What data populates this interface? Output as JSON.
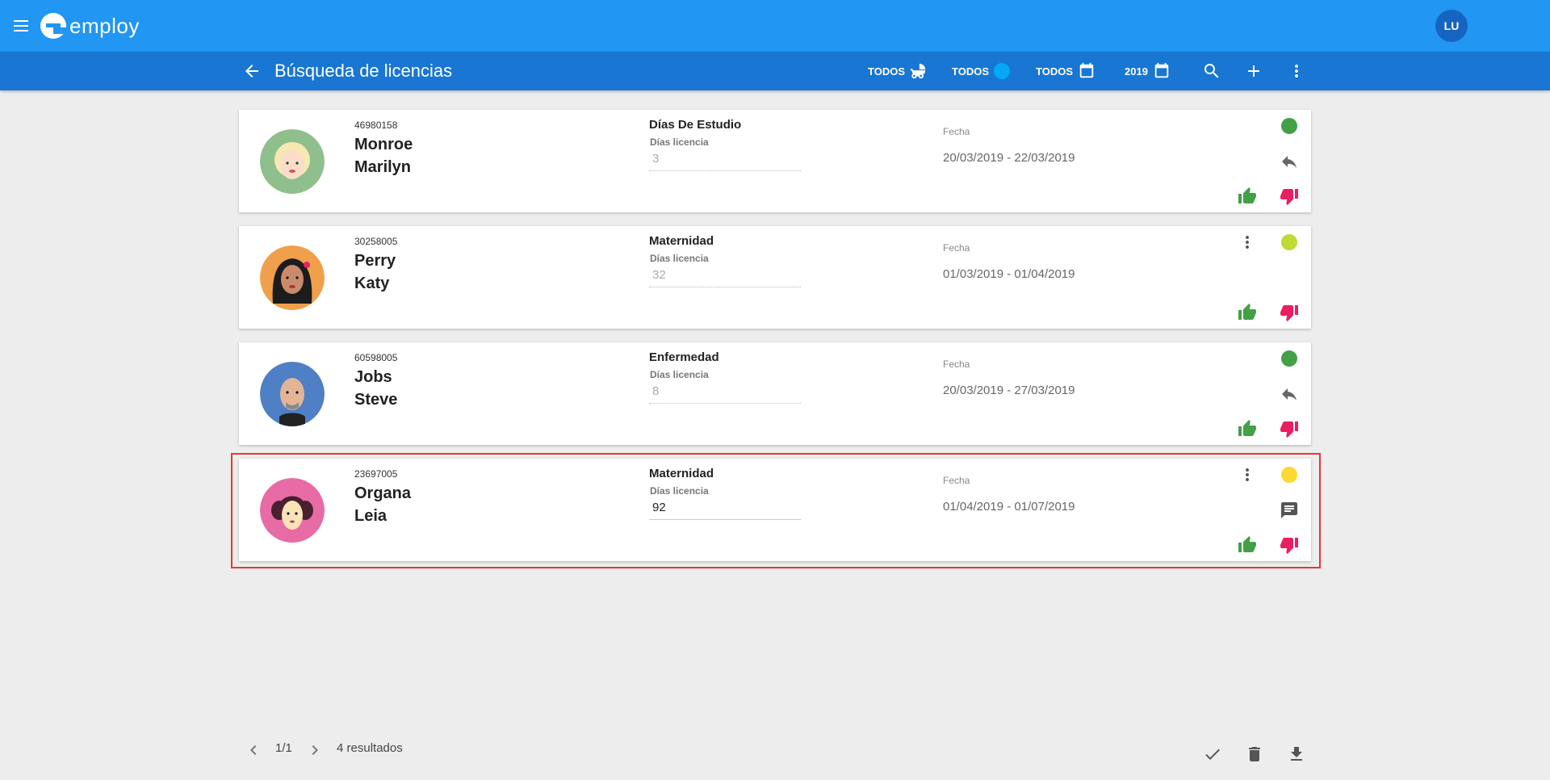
{
  "app": {
    "logo_text": "employ",
    "user_initials": "LU"
  },
  "header": {
    "title": "Búsqueda de licencias",
    "filters": [
      {
        "label": "TODOS",
        "icon": "baby-carriage-icon"
      },
      {
        "label": "TODOS",
        "icon": "blue-circle-icon"
      },
      {
        "label": "TODOS",
        "icon": "calendar-icon"
      },
      {
        "label": "2019",
        "icon": "calendar-icon"
      }
    ]
  },
  "cards": [
    {
      "id": "46980158",
      "last": "Monroe",
      "first": "Marilyn",
      "type": "Días De Estudio",
      "days_label": "Días licencia",
      "days": "3",
      "date_label": "Fecha",
      "dates": "20/03/2019 - 22/03/2019",
      "status_color": "#43a047",
      "side_icon": "reply-icon",
      "avatar_bg": "#8fbf8c"
    },
    {
      "id": "30258005",
      "last": "Perry",
      "first": "Katy",
      "type": "Maternidad",
      "days_label": "Días licencia",
      "days": "32",
      "date_label": "Fecha",
      "dates": "01/03/2019 - 01/04/2019",
      "status_color": "#c0d934",
      "side_icon": "more-vert-icon",
      "avatar_bg": "#f0a04b"
    },
    {
      "id": "60598005",
      "last": "Jobs",
      "first": "Steve",
      "type": "Enfermedad",
      "days_label": "Días licencia",
      "days": "8",
      "date_label": "Fecha",
      "dates": "20/03/2019 - 27/03/2019",
      "status_color": "#43a047",
      "side_icon": "reply-icon",
      "avatar_bg": "#4f7fc4"
    },
    {
      "id": "23697005",
      "last": "Organa",
      "first": "Leia",
      "type": "Maternidad",
      "days_label": "Días licencia",
      "days": "92",
      "date_label": "Fecha",
      "dates": "01/04/2019 - 01/07/2019",
      "status_color": "#fdd835",
      "side_icon": "comment-icon",
      "avatar_bg": "#e76ca6"
    }
  ],
  "footer": {
    "page": "1/1",
    "results": "4 resultados"
  },
  "colors": {
    "primary": "#2196f3",
    "primary_dark": "#1976d2",
    "approve": "#43a047",
    "reject": "#e91e63",
    "highlight": "#e53935"
  }
}
